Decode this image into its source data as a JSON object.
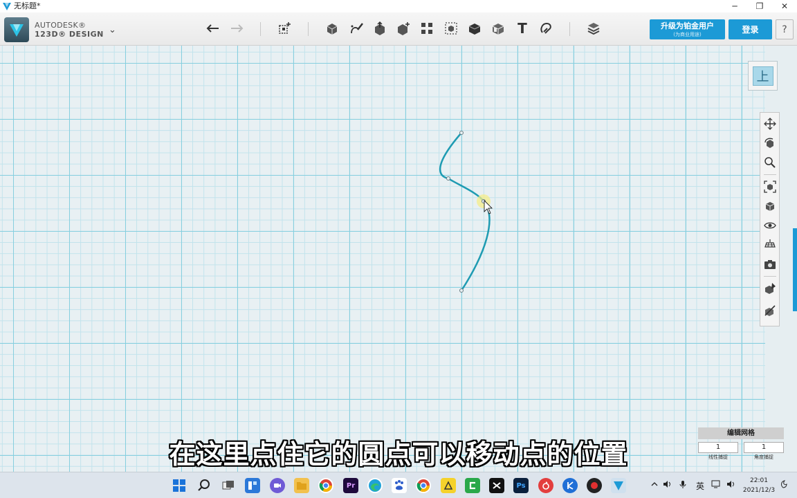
{
  "window": {
    "title": "无标题*",
    "minimize": "─",
    "maximize": "❐",
    "close": "✕"
  },
  "brand": {
    "line1": "AUTODESK®",
    "line2": "123D® DESIGN",
    "menu_chevron": "⌄"
  },
  "toolbar": {
    "tools": [
      "undo-icon",
      "redo-icon",
      "transform-icon",
      "primitives-icon",
      "sketch-icon",
      "construct-icon",
      "modify-icon",
      "pattern-icon",
      "group-icon",
      "combine-icon",
      "measure-icon",
      "text-icon",
      "snap-icon",
      "material-icon"
    ],
    "text_tool_glyph": "T"
  },
  "account": {
    "upgrade_label": "升级为铂金用户",
    "upgrade_sub": "(为商业用途)",
    "login_label": "登录",
    "help_label": "?"
  },
  "viewcube": {
    "face_label": "上"
  },
  "navigation": {
    "items": [
      "pan-icon",
      "orbit-icon",
      "zoom-icon",
      "fit-icon",
      "views-icon",
      "visibility-icon",
      "grid-icon",
      "camera-icon",
      "material-tool-icon",
      "snap-tool-icon"
    ]
  },
  "grid_panel": {
    "title": "编辑网格",
    "value_1": "1",
    "value_2": "1",
    "label_1": "线性捕捉",
    "label_2": "角度捕捉"
  },
  "subtitle": "在这里点住它的圆点可以移动点的位置",
  "taskbar": {
    "apps": [
      "start-icon",
      "search-icon",
      "task-view-icon",
      "widgets-icon",
      "chat-icon",
      "explorer-icon",
      "chrome-icon",
      "premiere-icon",
      "edge-icon",
      "baidu-icon",
      "chrome2-icon",
      "app-icon",
      "camtasia-icon",
      "capcut-icon",
      "photoshop-icon",
      "netease-icon",
      "k-icon",
      "record-icon",
      "123d-icon"
    ],
    "premiere_label": "Pr",
    "ps_label": "Ps",
    "ime": "英",
    "clock_time": "22:01",
    "clock_date": "2021/12/3"
  },
  "colors": {
    "accent": "#1c9ad6",
    "curve": "#1e9bb2",
    "grid_major": "#86cfdf",
    "grid_minor": "#c2e3ec"
  }
}
